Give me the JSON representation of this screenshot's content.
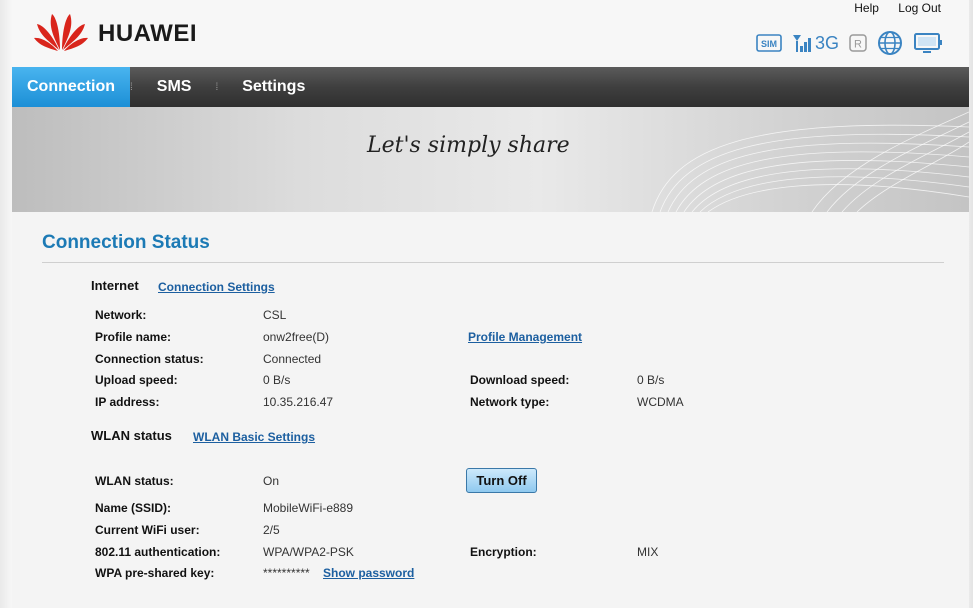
{
  "header": {
    "brand": "HUAWEI",
    "help": "Help",
    "logout": "Log Out",
    "status_icons": {
      "sim": "SIM",
      "network_gen": "3G",
      "roaming": "R"
    }
  },
  "nav": {
    "tabs": [
      {
        "label": "Connection",
        "active": true
      },
      {
        "label": "SMS",
        "active": false
      },
      {
        "label": "Settings",
        "active": false
      }
    ]
  },
  "banner": {
    "slogan": "Let's simply share"
  },
  "main": {
    "title": "Connection Status",
    "internet": {
      "heading": "Internet",
      "settings_link": "Connection Settings",
      "rows": {
        "network": {
          "label": "Network:",
          "value": "CSL"
        },
        "profile": {
          "label": "Profile name:",
          "value": "onw2free(D)"
        },
        "conn_status": {
          "label": "Connection status:",
          "value": "Connected"
        },
        "upload": {
          "label": "Upload speed:",
          "value": "0 B/s"
        },
        "ip": {
          "label": "IP address:",
          "value": "10.35.216.47"
        },
        "download": {
          "label": "Download speed:",
          "value": "0 B/s"
        },
        "net_type": {
          "label": "Network type:",
          "value": "WCDMA"
        }
      },
      "profile_link": "Profile Management"
    },
    "wlan": {
      "heading": "WLAN status",
      "settings_link": "WLAN Basic Settings",
      "rows": {
        "status": {
          "label": "WLAN status:",
          "value": "On"
        },
        "ssid": {
          "label": "Name (SSID):",
          "value": "MobileWiFi-e889"
        },
        "users": {
          "label": "Current WiFi user:",
          "value": "2/5"
        },
        "auth": {
          "label": "802.11 authentication:",
          "value": "WPA/WPA2-PSK"
        },
        "encryption": {
          "label": "Encryption:",
          "value": "MIX"
        },
        "psk": {
          "label": "WPA pre-shared key:",
          "value": "**********"
        }
      },
      "turn_off": "Turn Off",
      "show_password": "Show password"
    }
  },
  "colors": {
    "accent_blue": "#1c7ab5",
    "nav_active": "#2a9be0",
    "huawei_red": "#d9251c"
  }
}
